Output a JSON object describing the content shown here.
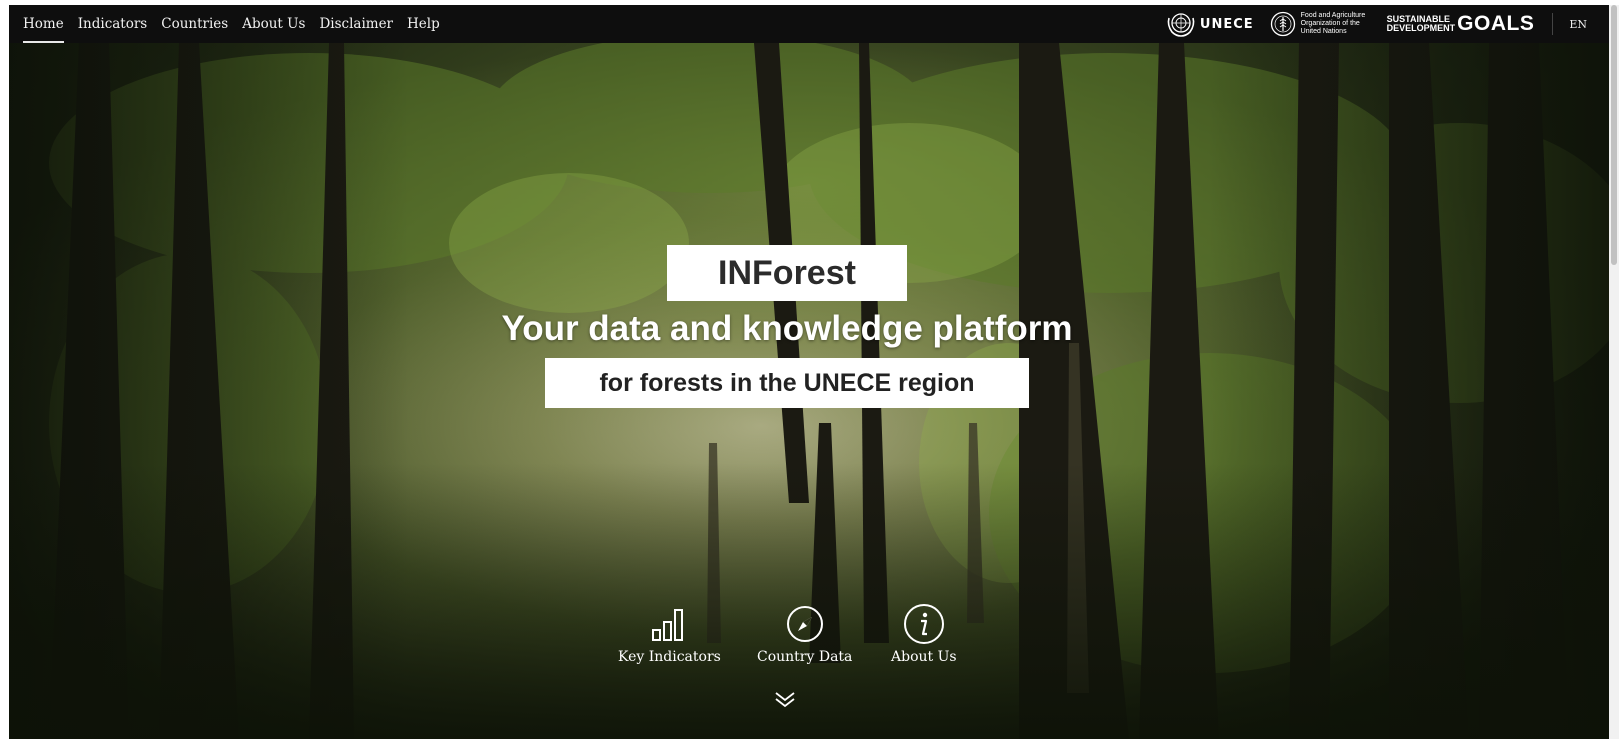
{
  "nav": {
    "items": [
      {
        "label": "Home",
        "active": true
      },
      {
        "label": "Indicators",
        "active": false
      },
      {
        "label": "Countries",
        "active": false
      },
      {
        "label": "About Us",
        "active": false
      },
      {
        "label": "Disclaimer",
        "active": false
      },
      {
        "label": "Help",
        "active": false
      }
    ]
  },
  "logos": {
    "unece": "UNECE",
    "fao": "Food and Agriculture Organization of the United Nations",
    "sdg_small_1": "SUSTAINABLE",
    "sdg_small_2": "DEVELOPMENT",
    "sdg_big": "GOALS"
  },
  "language": "EN",
  "hero": {
    "title": "INForest",
    "subtitle": "Your data and knowledge platform",
    "tagline": "for forests in the UNECE region"
  },
  "quick_links": [
    {
      "label": "Key Indicators",
      "icon": "bar-chart-icon"
    },
    {
      "label": "Country Data",
      "icon": "compass-icon"
    },
    {
      "label": "About Us",
      "icon": "info-icon"
    }
  ],
  "colors": {
    "topbar": "#0e0e0e",
    "forest_dark": "#1a1f12",
    "forest_light": "#b8b48a",
    "text_dark": "#2b2b2b"
  }
}
